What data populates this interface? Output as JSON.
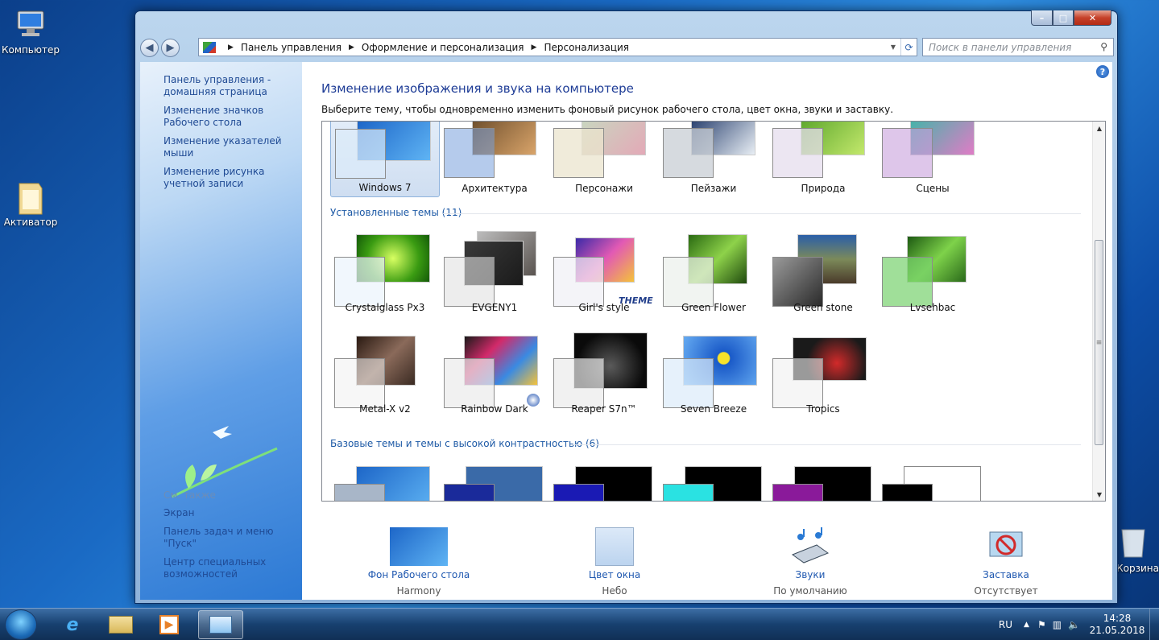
{
  "desktop": {
    "icons": [
      {
        "label": "Компьютер"
      },
      {
        "label": "Активатор"
      },
      {
        "label": "Корзина"
      }
    ]
  },
  "window": {
    "buttons": {
      "minimize": "–",
      "maximize": "□",
      "close": "✕"
    },
    "breadcrumb": [
      "Панель управления",
      "Оформление и персонализация",
      "Персонализация"
    ],
    "search_placeholder": "Поиск в панели управления"
  },
  "sidebar": {
    "links": [
      "Панель управления - домашняя страница",
      "Изменение значков Рабочего стола",
      "Изменение указателей мыши",
      "Изменение рисунка учетной записи"
    ],
    "see_also_header": "См. также",
    "see_also": [
      "Экран",
      "Панель задач и меню \"Пуск\"",
      "Центр специальных возможностей"
    ]
  },
  "main": {
    "title": "Изменение изображения и звука на компьютере",
    "subtitle": "Выберите тему, чтобы одновременно изменить фоновый рисунок рабочего стола, цвет окна, звуки и заставку.",
    "aero_themes": [
      "Windows 7",
      "Архитектура",
      "Персонажи",
      "Пейзажи",
      "Природа",
      "Сцены"
    ],
    "selected_theme": "Windows 7",
    "installed_header": "Установленные темы (11)",
    "installed_themes": [
      "Crystalglass Px3",
      "EVGENY1",
      "Girl's style",
      "Green Flower",
      "Green stone",
      "Lvsehbac",
      "Metal-X v2",
      "Rainbow Dark",
      "Reaper S7n™",
      "Seven Breeze",
      "Tropics"
    ],
    "girls_style_overlay": "THEME",
    "basic_header": "Базовые темы и темы с высокой контрастностью (6)"
  },
  "bottom": [
    {
      "link": "Фон Рабочего стола",
      "value": "Harmony"
    },
    {
      "link": "Цвет окна",
      "value": "Небо"
    },
    {
      "link": "Звуки",
      "value": "По умолчанию"
    },
    {
      "link": "Заставка",
      "value": "Отсутствует"
    }
  ],
  "taskbar": {
    "language": "RU",
    "time": "14:28",
    "date": "21.05.2018"
  },
  "colors": {
    "link": "#1f58b0",
    "title": "#1e3c96",
    "section": "#1e5aa6"
  }
}
